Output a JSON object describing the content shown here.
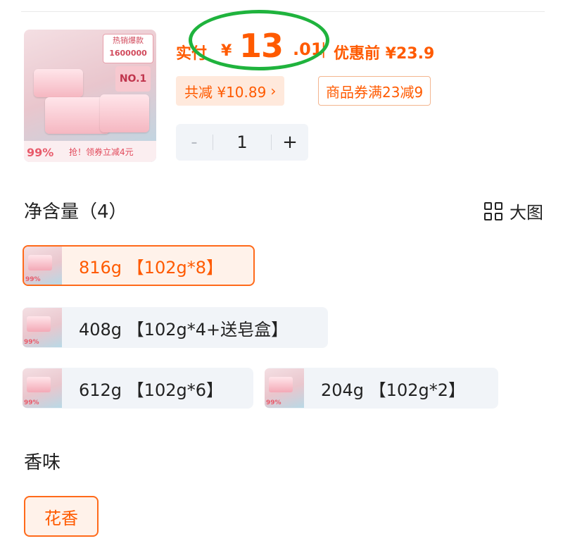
{
  "product": {
    "thumb_badge_top": "热销爆款",
    "thumb_sales": "1600000",
    "thumb_rank": "NO.1",
    "thumb_percent": "99%",
    "thumb_promo": "抢！领券立减4元"
  },
  "price": {
    "label": "实付",
    "currency": "¥",
    "integer": "13",
    "decimal": ".01",
    "separator": "|",
    "before_label": "优惠前 ¥23.9",
    "accent_color": "#ff5a00",
    "annotation_color": "#1fb33d"
  },
  "discount": {
    "total": "共减 ¥10.89",
    "total_chevron": "›",
    "coupon": "商品券满23减9"
  },
  "stepper": {
    "minus": "-",
    "value": "1",
    "plus": "+"
  },
  "spec": {
    "title": "净含量（4）",
    "big_view": "大图",
    "options": [
      {
        "label": "816g 【102g*8】",
        "selected": true,
        "thumb_percent": "99%"
      },
      {
        "label": "408g 【102g*4+送皂盒】",
        "selected": false,
        "thumb_percent": "99%"
      },
      {
        "label": "612g 【102g*6】",
        "selected": false,
        "thumb_percent": "99%"
      },
      {
        "label": "204g 【102g*2】",
        "selected": false,
        "thumb_percent": "99%"
      }
    ]
  },
  "scent": {
    "title": "香味",
    "options": [
      {
        "label": "花香",
        "selected": true
      }
    ]
  }
}
